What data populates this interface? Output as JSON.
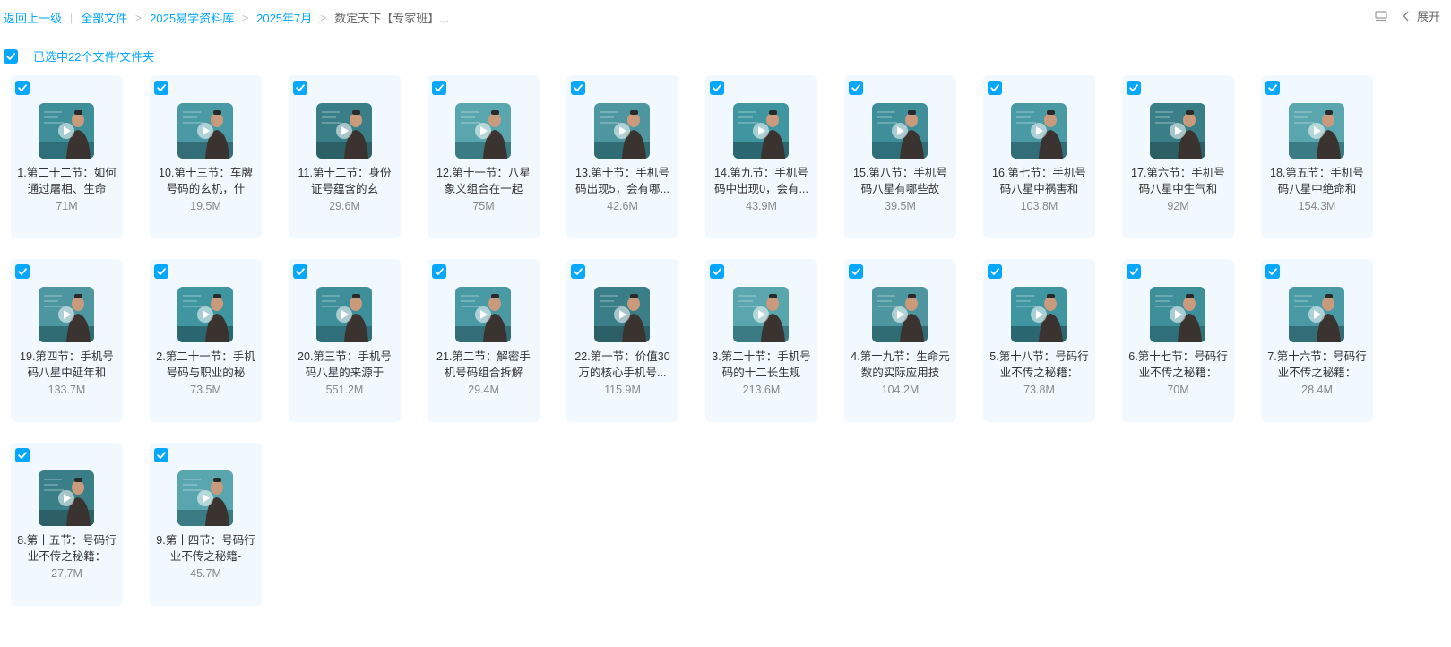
{
  "breadcrumb": {
    "back": "返回上一级",
    "items": [
      "全部文件",
      "2025易学资料库",
      "2025年7月",
      "数定天下【专家班】..."
    ]
  },
  "toolbar": {
    "expand_label": "展开"
  },
  "selection": {
    "text": "已选中22个文件/文件夹",
    "checked": true
  },
  "colors": {
    "accent": "#06a7ff",
    "card_bg": "#f1f8fe"
  },
  "files": [
    {
      "name": "1.第二十二节：如何通过屠相、生命",
      "size": "71M",
      "icon": "video-thumbnail",
      "checked": true
    },
    {
      "name": "10.第十三节：车牌号码的玄机，什",
      "size": "19.5M",
      "icon": "video-thumbnail",
      "checked": true
    },
    {
      "name": "11.第十二节：身份证号蕴含的玄",
      "size": "29.6M",
      "icon": "video-thumbnail",
      "checked": true
    },
    {
      "name": "12.第十一节：八星象义组合在一起",
      "size": "75M",
      "icon": "video-thumbnail",
      "checked": true
    },
    {
      "name": "13.第十节：手机号码出现5，会有哪...",
      "size": "42.6M",
      "icon": "video-thumbnail",
      "checked": true
    },
    {
      "name": "14.第九节：手机号码中出现0，会有...",
      "size": "43.9M",
      "icon": "video-thumbnail",
      "checked": true
    },
    {
      "name": "15.第八节：手机号码八星有哪些故",
      "size": "39.5M",
      "icon": "video-thumbnail",
      "checked": true
    },
    {
      "name": "16.第七节：手机号码八星中祸害和",
      "size": "103.8M",
      "icon": "video-thumbnail",
      "checked": true
    },
    {
      "name": "17.第六节：手机号码八星中生气和",
      "size": "92M",
      "icon": "video-thumbnail",
      "checked": true
    },
    {
      "name": "18.第五节：手机号码八星中绝命和",
      "size": "154.3M",
      "icon": "video-thumbnail",
      "checked": true
    },
    {
      "name": "19.第四节：手机号码八星中延年和",
      "size": "133.7M",
      "icon": "video-thumbnail",
      "checked": true
    },
    {
      "name": "2.第二十一节：手机号码与职业的秘",
      "size": "73.5M",
      "icon": "video-thumbnail",
      "checked": true
    },
    {
      "name": "20.第三节：手机号码八星的来源于",
      "size": "551.2M",
      "icon": "video-thumbnail",
      "checked": true
    },
    {
      "name": "21.第二节：解密手机号码组合拆解",
      "size": "29.4M",
      "icon": "video-thumbnail",
      "checked": true
    },
    {
      "name": "22.第一节：价值30万的核心手机号...",
      "size": "115.9M",
      "icon": "video-thumbnail",
      "checked": true
    },
    {
      "name": "3.第二十节：手机号码的十二长生规",
      "size": "213.6M",
      "icon": "video-thumbnail",
      "checked": true
    },
    {
      "name": "4.第十九节：生命元数的实际应用技",
      "size": "104.2M",
      "icon": "video-thumbnail",
      "checked": true
    },
    {
      "name": "5.第十八节：号码行业不传之秘籍：",
      "size": "73.8M",
      "icon": "video-thumbnail",
      "checked": true
    },
    {
      "name": "6.第十七节：号码行业不传之秘籍：",
      "size": "70M",
      "icon": "video-thumbnail",
      "checked": true
    },
    {
      "name": "7.第十六节：号码行业不传之秘籍：",
      "size": "28.4M",
      "icon": "video-thumbnail",
      "checked": true
    },
    {
      "name": "8.第十五节：号码行业不传之秘籍：",
      "size": "27.7M",
      "icon": "video-thumbnail",
      "checked": true
    },
    {
      "name": "9.第十四节：号码行业不传之秘籍-",
      "size": "45.7M",
      "icon": "video-thumbnail",
      "checked": true
    }
  ]
}
